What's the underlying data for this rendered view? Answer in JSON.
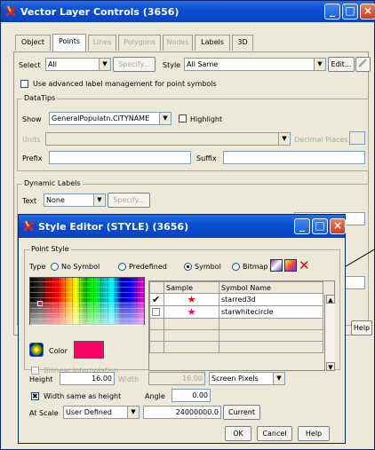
{
  "main_window": {
    "title": "Vector Layer Controls (3656)",
    "tabs": [
      {
        "label": "Object",
        "enabled": true
      },
      {
        "label": "Points",
        "enabled": true,
        "active": true
      },
      {
        "label": "Lines",
        "enabled": false
      },
      {
        "label": "Polygons",
        "enabled": false
      },
      {
        "label": "Nodes",
        "enabled": false
      },
      {
        "label": "Labels",
        "enabled": true
      },
      {
        "label": "3D",
        "enabled": true
      }
    ],
    "select_label": "Select",
    "select_value": "All",
    "specify_label": "Specify...",
    "style_label": "Style",
    "style_value": "All Same",
    "edit_label": "Edit...",
    "advanced_label": "Use advanced label management for point symbols",
    "datatips": {
      "title": "DataTips",
      "show_label": "Show",
      "show_value": "GeneralPopulatn.CITYNAME",
      "highlight_label": "Highlight",
      "units_label": "Units",
      "decimal_label": "Decimal Places",
      "prefix_label": "Prefix",
      "suffix_label": "Suffix"
    },
    "dynamic_labels": {
      "title": "Dynamic Labels",
      "text_label": "Text",
      "text_value": "None",
      "specify_label": "Specify..."
    },
    "help_partial": "Help"
  },
  "style_editor": {
    "title": "Style Editor (STYLE) (3656)",
    "point_style_title": "Point Style",
    "type_label": "Type",
    "type_options": [
      "No Symbol",
      "Predefined",
      "Symbol",
      "Bitmap"
    ],
    "selected_type": "Symbol",
    "color_label": "Color",
    "color_value": "#ff0066",
    "bilinear_label": "Bilinear Interpolation",
    "table_headers": [
      "Sample",
      "Symbol Name"
    ],
    "symbols": [
      {
        "name": "starred3d",
        "checked": true,
        "star_color": "#ff0000"
      },
      {
        "name": "starwhitecircle",
        "checked": false,
        "star_color": "#ff0066"
      }
    ],
    "height_label": "Height",
    "height_value": "16.00",
    "width_label": "Width",
    "width_value": "16.00",
    "units_value": "Screen Pixels",
    "same_label": "Width same as height",
    "angle_label": "Angle",
    "angle_value": "0.00",
    "scale_label": "At Scale",
    "scale_type": "User Defined",
    "scale_value": "24000000.0",
    "current_label": "Current",
    "ok_label": "OK",
    "cancel_label": "Cancel",
    "help_label": "Help"
  }
}
